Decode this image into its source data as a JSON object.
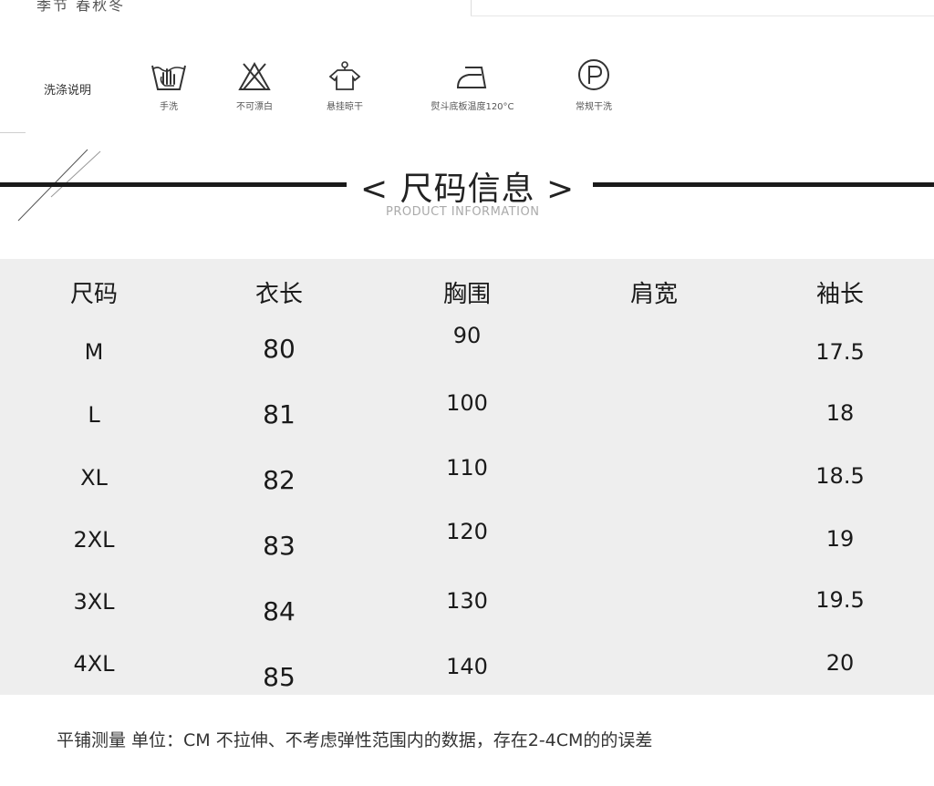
{
  "top_strip": {
    "season_text": "季节  春秋冬"
  },
  "washing": {
    "label": "洗涤说明",
    "items": [
      {
        "icon": "hand-wash-icon",
        "label": "手洗"
      },
      {
        "icon": "no-bleach-icon",
        "label": "不可漂白"
      },
      {
        "icon": "hang-dry-icon",
        "label": "悬挂晾干"
      },
      {
        "icon": "iron-icon",
        "label": "熨斗底板温度120°C"
      },
      {
        "icon": "dry-clean-p-icon",
        "label": "常规干洗"
      }
    ]
  },
  "section_header": {
    "title": "< 尺码信息 >",
    "subtitle": "PRODUCT INFORMATION"
  },
  "size_table": {
    "headers": [
      "尺码",
      "衣长",
      "胸围",
      "肩宽",
      "袖长"
    ],
    "rows": [
      {
        "size": "M",
        "length": "80",
        "chest": "90",
        "shoulder": "",
        "sleeve": "17.5"
      },
      {
        "size": "L",
        "length": "81",
        "chest": "100",
        "shoulder": "",
        "sleeve": "18"
      },
      {
        "size": "XL",
        "length": "82",
        "chest": "110",
        "shoulder": "",
        "sleeve": "18.5"
      },
      {
        "size": "2XL",
        "length": "83",
        "chest": "120",
        "shoulder": "",
        "sleeve": "19"
      },
      {
        "size": "3XL",
        "length": "84",
        "chest": "130",
        "shoulder": "",
        "sleeve": "19.5"
      },
      {
        "size": "4XL",
        "length": "85",
        "chest": "140",
        "shoulder": "",
        "sleeve": "20"
      }
    ]
  },
  "note": "平铺测量 单位：CM 不拉伸、不考虑弹性范围内的数据，存在2-4CM的的误差"
}
